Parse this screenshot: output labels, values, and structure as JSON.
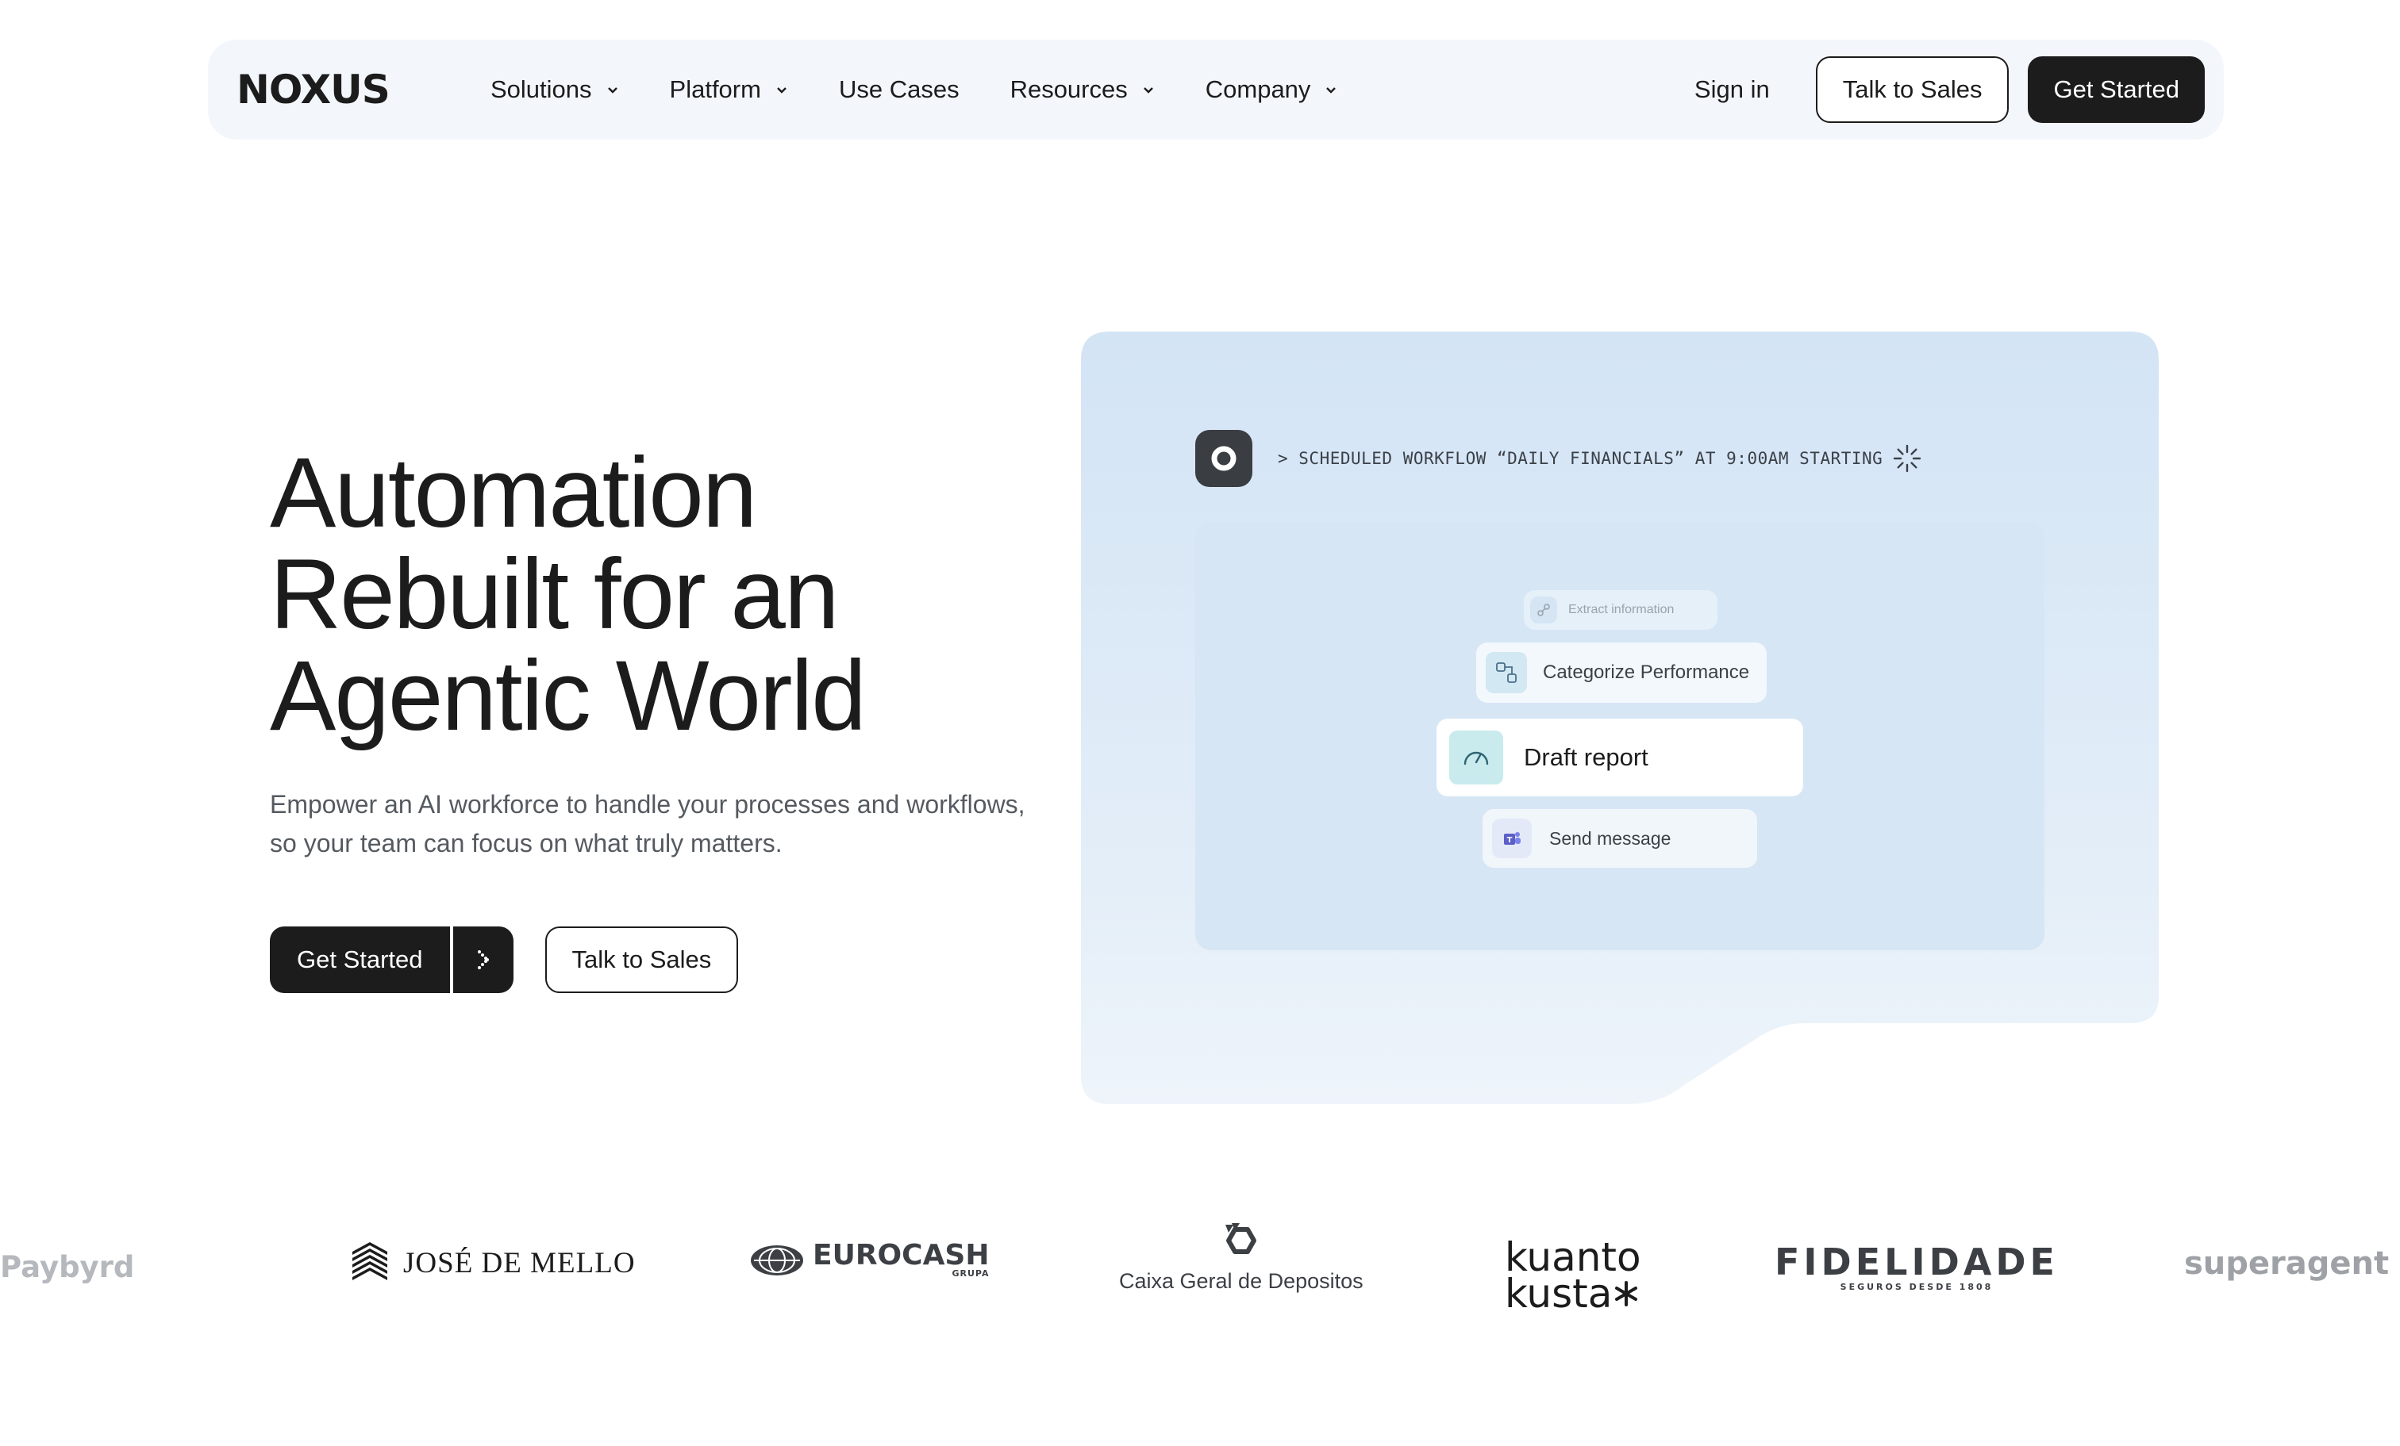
{
  "nav": {
    "logo": "NOXUS",
    "links": [
      {
        "label": "Solutions",
        "has_dropdown": true
      },
      {
        "label": "Platform",
        "has_dropdown": true
      },
      {
        "label": "Use Cases",
        "has_dropdown": false
      },
      {
        "label": "Resources",
        "has_dropdown": true
      },
      {
        "label": "Company",
        "has_dropdown": true
      }
    ],
    "sign_in": "Sign in",
    "talk_to_sales": "Talk to Sales",
    "get_started": "Get Started"
  },
  "hero": {
    "title_lines": [
      "Automation",
      "Rebuilt for an",
      "Agentic World"
    ],
    "subtitle_lines": [
      "Empower an AI workforce to handle your processes and workflows,",
      "so your team can focus on what truly matters."
    ],
    "cta_primary": "Get Started",
    "cta_secondary": "Talk to Sales"
  },
  "workflow_demo": {
    "status_text": "> SCHEDULED WORKFLOW “DAILY FINANCIALS” AT 9:00AM STARTING",
    "steps": [
      {
        "label": "Extract information",
        "icon": "link-icon"
      },
      {
        "label": "Categorize Performance",
        "icon": "shapes-icon"
      },
      {
        "label": "Draft report",
        "icon": "gauge-icon"
      },
      {
        "label": "Send message",
        "icon": "teams-icon"
      }
    ]
  },
  "logos": {
    "paybyrd": "Paybyrd",
    "jose_de_mello": "JOSÉ DE MELLO",
    "eurocash": "EUROCASH",
    "eurocash_sub": "GRUPA",
    "caixa": "Caixa Geral de Depositos",
    "kuanto_line1": "kuanto",
    "kuanto_line2": "kusta",
    "fidelidade": "FIDELIDADE",
    "fidelidade_sub": "SEGUROS DESDE 1808",
    "superagent": "superagent"
  },
  "colors": {
    "dark": "#1c1c1c",
    "nav_bg": "#f3f7fb",
    "panel_top": "#d3e4f5",
    "panel_bottom": "#eef4fa"
  }
}
